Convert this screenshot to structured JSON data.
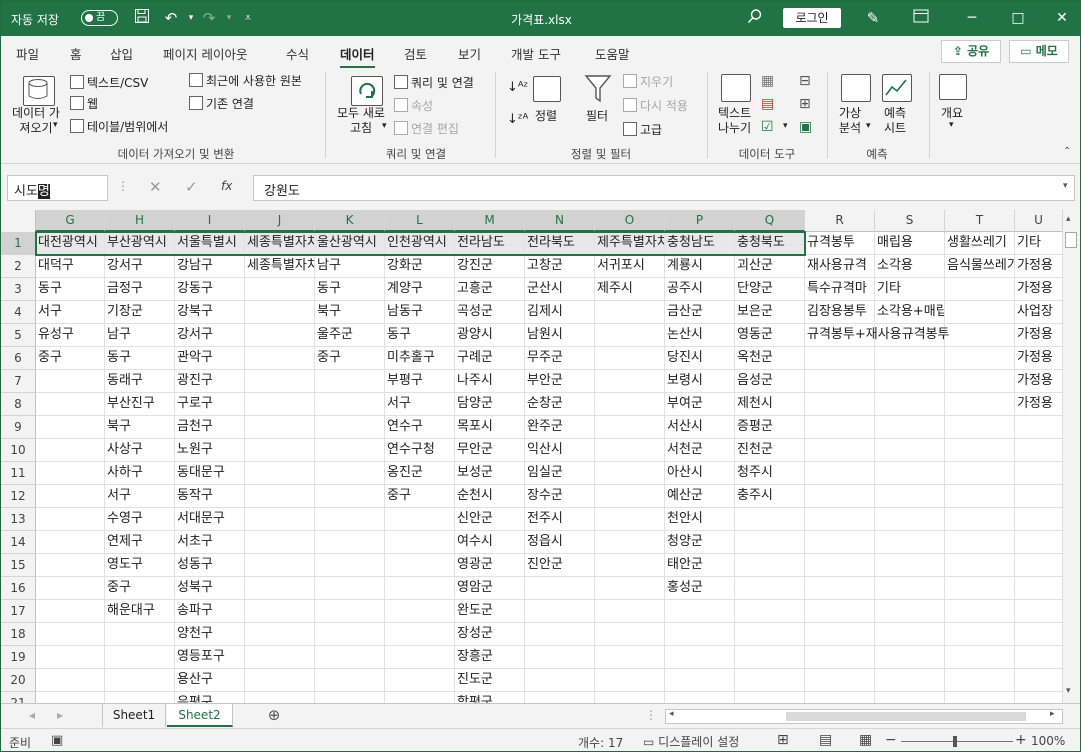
{
  "titlebar": {
    "autosave_label": "자동 저장",
    "autosave_state": "끔",
    "doc_title": "가격표.xlsx",
    "login": "로그인"
  },
  "tabs": [
    "파일",
    "홈",
    "삽입",
    "페이지 레이아웃",
    "수식",
    "데이터",
    "검토",
    "보기",
    "개발 도구",
    "도움말"
  ],
  "active_tab": "데이터",
  "share": "공유",
  "memo": "메모",
  "ribbon": {
    "get_data": "데이터 가\n져오기",
    "text_csv": "텍스트/CSV",
    "web": "웹",
    "table_range": "테이블/범위에서",
    "recent_sources": "최근에 사용한 원본",
    "existing_conn": "기존 연결",
    "group1": "데이터 가져오기 및 변환",
    "refresh_all": "모두 새로\n고침",
    "queries_conn": "쿼리 및 연결",
    "properties": "속성",
    "edit_links": "연결 편집",
    "group2": "쿼리 및 연결",
    "sort": "정렬",
    "filter": "필터",
    "clear": "지우기",
    "reapply": "다시 적용",
    "advanced": "고급",
    "group3": "정렬 및 필터",
    "text_to_cols": "텍스트\n나누기",
    "group4": "데이터 도구",
    "what_if": "가상\n분석",
    "forecast": "예측\n시트",
    "group5": "예측",
    "outline": "개요"
  },
  "namebox": {
    "pre": "시도",
    "sel": "명"
  },
  "formula": "강원도",
  "columns": [
    "G",
    "H",
    "I",
    "J",
    "K",
    "L",
    "M",
    "N",
    "O",
    "P",
    "Q",
    "R",
    "S",
    "T",
    "U"
  ],
  "rows": [
    "1",
    "2",
    "3",
    "4",
    "5",
    "6",
    "7",
    "8",
    "9",
    "10",
    "11",
    "12",
    "13",
    "14",
    "15",
    "16",
    "17",
    "18",
    "19",
    "20",
    "21"
  ],
  "cells": {
    "G": [
      "대전광역시",
      "대덕구",
      "동구",
      "서구",
      "유성구",
      "중구",
      "",
      "",
      "",
      "",
      "",
      "",
      "",
      "",
      "",
      "",
      "",
      "",
      "",
      "",
      ""
    ],
    "H": [
      "부산광역시",
      "강서구",
      "금정구",
      "기장군",
      "남구",
      "동구",
      "동래구",
      "부산진구",
      "북구",
      "사상구",
      "사하구",
      "서구",
      "수영구",
      "연제구",
      "영도구",
      "중구",
      "해운대구",
      "",
      "",
      "",
      ""
    ],
    "I": [
      "서울특별시",
      "강남구",
      "강동구",
      "강북구",
      "강서구",
      "관악구",
      "광진구",
      "구로구",
      "금천구",
      "노원구",
      "동대문구",
      "동작구",
      "서대문구",
      "서초구",
      "성동구",
      "성북구",
      "송파구",
      "양천구",
      "영등포구",
      "용산구",
      "은평구"
    ],
    "J": [
      "세종특별자치시",
      "세종특별자치시",
      "",
      "",
      "",
      "",
      "",
      "",
      "",
      "",
      "",
      "",
      "",
      "",
      "",
      "",
      "",
      "",
      "",
      "",
      ""
    ],
    "K": [
      "울산광역시",
      "남구",
      "동구",
      "북구",
      "울주군",
      "중구",
      "",
      "",
      "",
      "",
      "",
      "",
      "",
      "",
      "",
      "",
      "",
      "",
      "",
      "",
      ""
    ],
    "L": [
      "인천광역시",
      "강화군",
      "계양구",
      "남동구",
      "동구",
      "미추홀구",
      "부평구",
      "서구",
      "연수구",
      "연수구청",
      "옹진군",
      "중구",
      "",
      "",
      "",
      "",
      "",
      "",
      "",
      "",
      ""
    ],
    "M": [
      "전라남도",
      "강진군",
      "고흥군",
      "곡성군",
      "광양시",
      "구례군",
      "나주시",
      "담양군",
      "목포시",
      "무안군",
      "보성군",
      "순천시",
      "신안군",
      "여수시",
      "영광군",
      "영암군",
      "완도군",
      "장성군",
      "장흥군",
      "진도군",
      "함평군"
    ],
    "N": [
      "전라북도",
      "고창군",
      "군산시",
      "김제시",
      "남원시",
      "무주군",
      "부안군",
      "순창군",
      "완주군",
      "익산시",
      "임실군",
      "장수군",
      "전주시",
      "정읍시",
      "진안군",
      "",
      "",
      "",
      "",
      "",
      ""
    ],
    "O": [
      "제주특별자치도",
      "서귀포시",
      "제주시",
      "",
      "",
      "",
      "",
      "",
      "",
      "",
      "",
      "",
      "",
      "",
      "",
      "",
      "",
      "",
      "",
      "",
      ""
    ],
    "P": [
      "충청남도",
      "계룡시",
      "공주시",
      "금산군",
      "논산시",
      "당진시",
      "보령시",
      "부여군",
      "서산시",
      "서천군",
      "아산시",
      "예산군",
      "천안시",
      "청양군",
      "태안군",
      "홍성군",
      "",
      "",
      "",
      "",
      ""
    ],
    "Q": [
      "충청북도",
      "괴산군",
      "단양군",
      "보은군",
      "영동군",
      "옥천군",
      "음성군",
      "제천시",
      "증평군",
      "진천군",
      "청주시",
      "충주시",
      "",
      "",
      "",
      "",
      "",
      "",
      "",
      "",
      ""
    ],
    "R": [
      "규격봉투",
      "재사용규격",
      "특수규격마",
      "김장용봉투",
      "규격봉투+재사용규격봉투",
      "",
      "",
      "",
      "",
      "",
      "",
      "",
      "",
      "",
      "",
      "",
      "",
      "",
      "",
      "",
      ""
    ],
    "S": [
      "매립용",
      "소각용",
      "기타",
      "소각용+매립용",
      "",
      "",
      "",
      "",
      "",
      "",
      "",
      "",
      "",
      "",
      "",
      "",
      "",
      "",
      "",
      "",
      ""
    ],
    "T": [
      "생활쓰레기",
      "음식물쓰레기",
      "",
      "",
      "",
      "",
      "",
      "",
      "",
      "",
      "",
      "",
      "",
      "",
      "",
      "",
      "",
      "",
      "",
      "",
      ""
    ],
    "U": [
      "기타",
      "가정용",
      "가정용",
      "사업장",
      "가정용",
      "가정용",
      "가정용",
      "가정용",
      "",
      "",
      "",
      "",
      "",
      "",
      "",
      "",
      "",
      "",
      "",
      "",
      ""
    ]
  },
  "sheets": [
    "Sheet1",
    "Sheet2"
  ],
  "active_sheet": "Sheet2",
  "status": {
    "ready": "준비",
    "count": "개수: 17",
    "display_settings": "디스플레이 설정",
    "zoom": "100%"
  },
  "colors": {
    "accent": "#217346"
  }
}
